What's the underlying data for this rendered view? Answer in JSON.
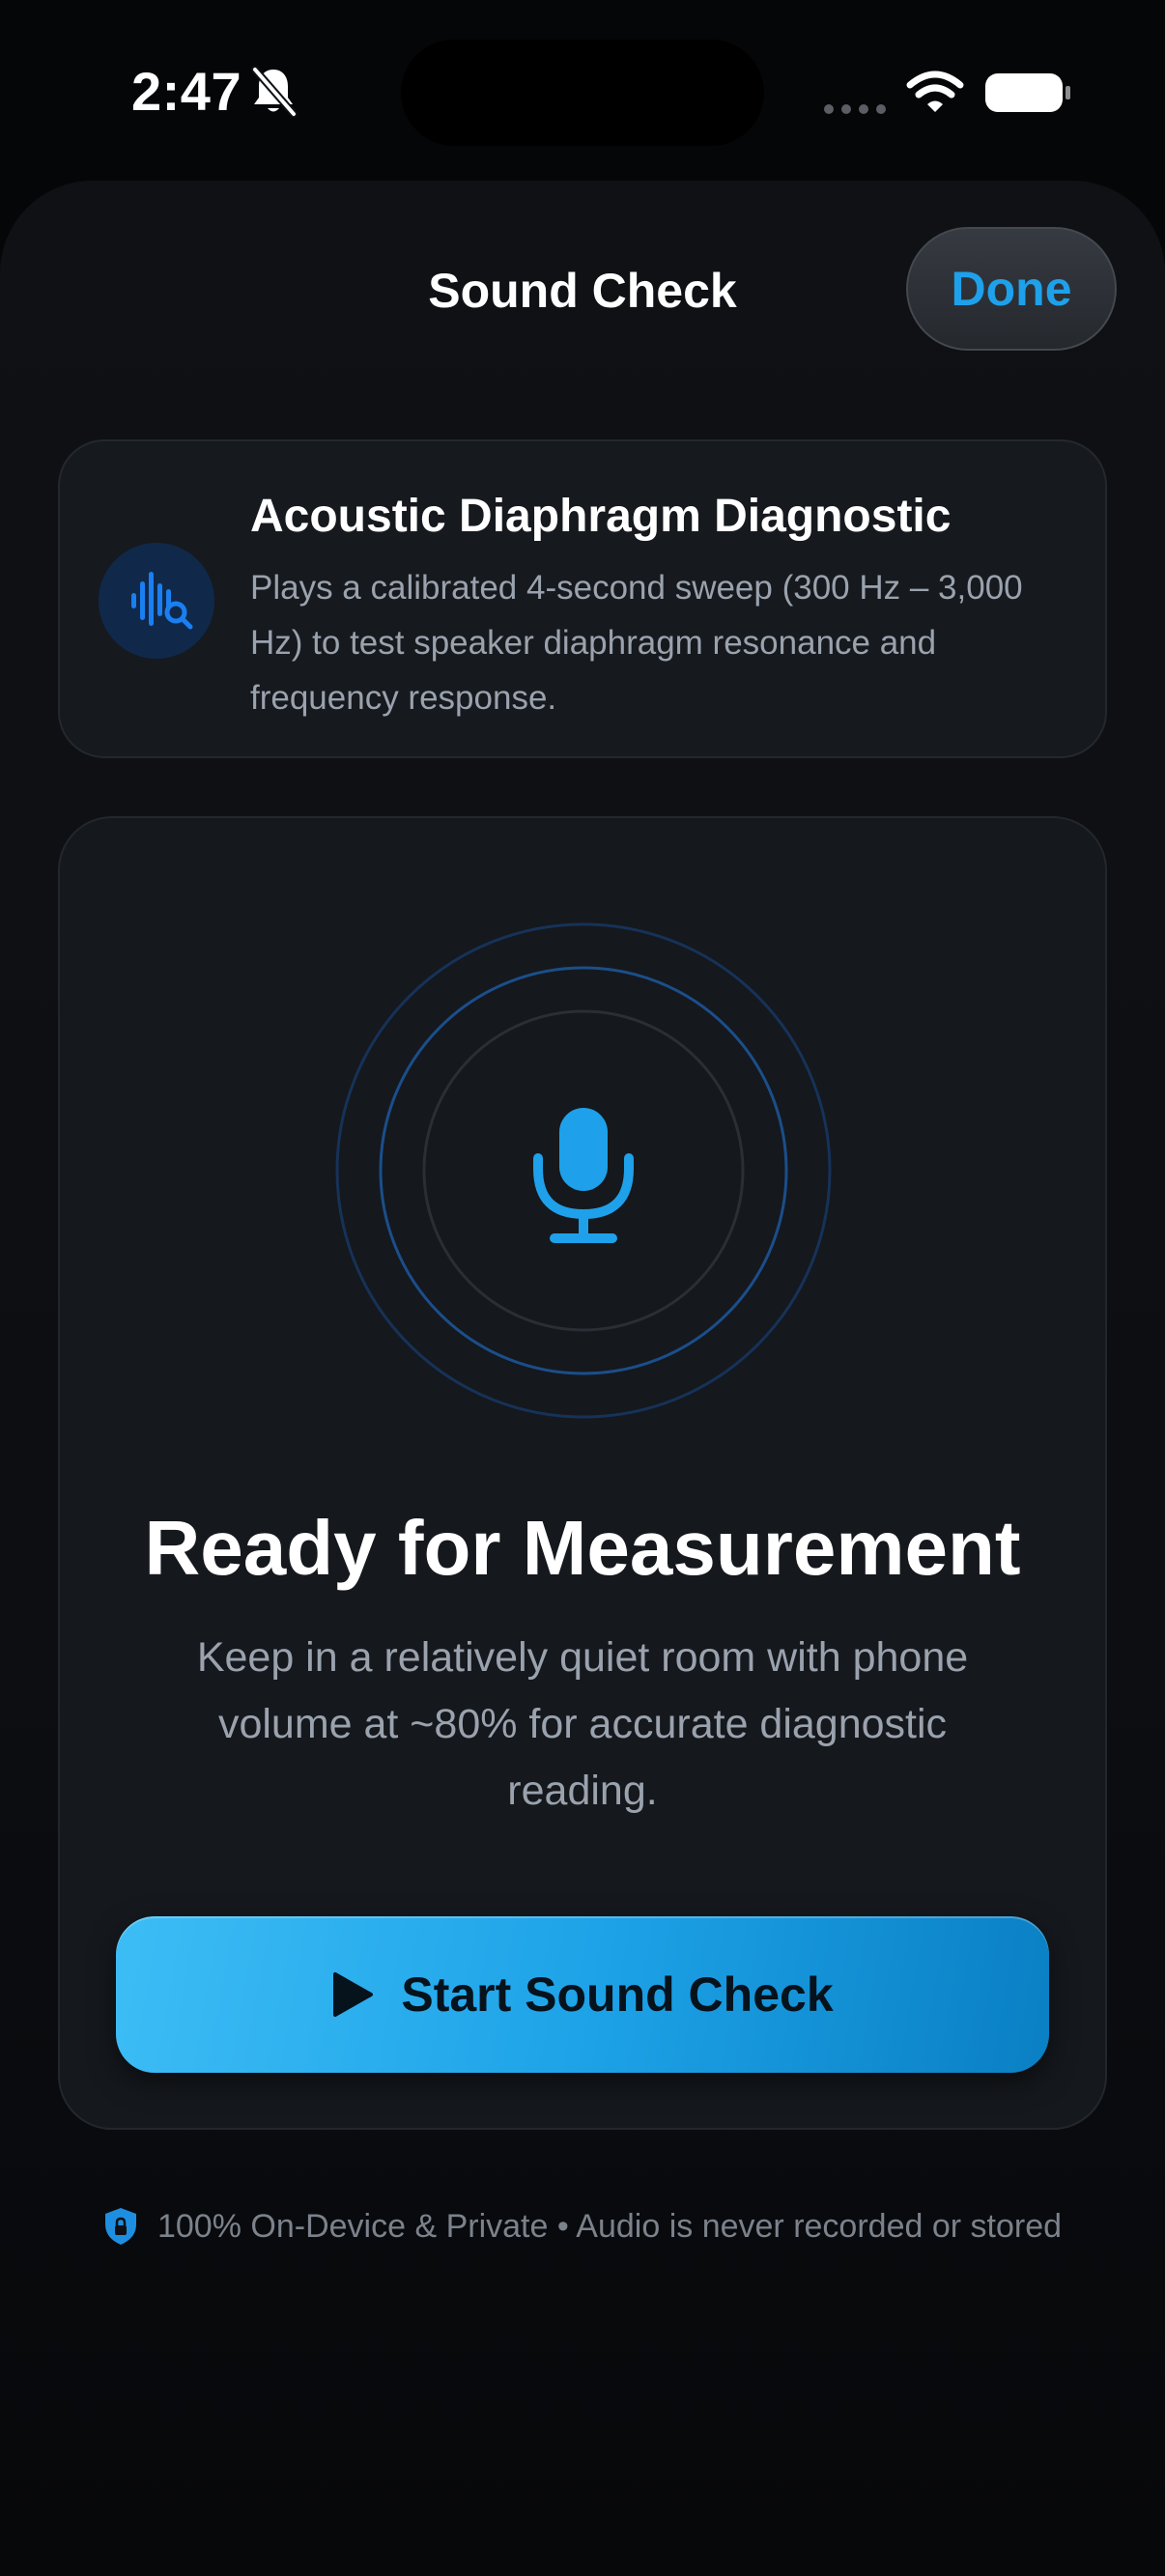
{
  "status_bar": {
    "time": "2:47"
  },
  "header": {
    "title": "Sound Check",
    "done_label": "Done"
  },
  "info_card": {
    "title": "Acoustic Diaphragm Diagnostic",
    "description": "Plays a calibrated 4-second sweep (300 Hz – 3,000 Hz) to test speaker diaphragm resonance and frequency response."
  },
  "main_card": {
    "title": "Ready for Measurement",
    "description": "Keep in a relatively quiet room with phone volume at ~80% for accurate diagnostic reading.",
    "start_label": "Start Sound Check"
  },
  "footer": {
    "text": "100% On-Device & Private • Audio is never recorded or stored"
  },
  "colors": {
    "accent": "#1ea1ea",
    "background": "#0f1115",
    "card": "#16191e"
  },
  "icons": {
    "status": [
      "bell-slash-icon",
      "signal-icon",
      "wifi-icon",
      "battery-icon"
    ],
    "info": "waveform-search-icon",
    "main": "microphone-icon",
    "button": "play-icon",
    "footer": "shield-lock-icon"
  }
}
